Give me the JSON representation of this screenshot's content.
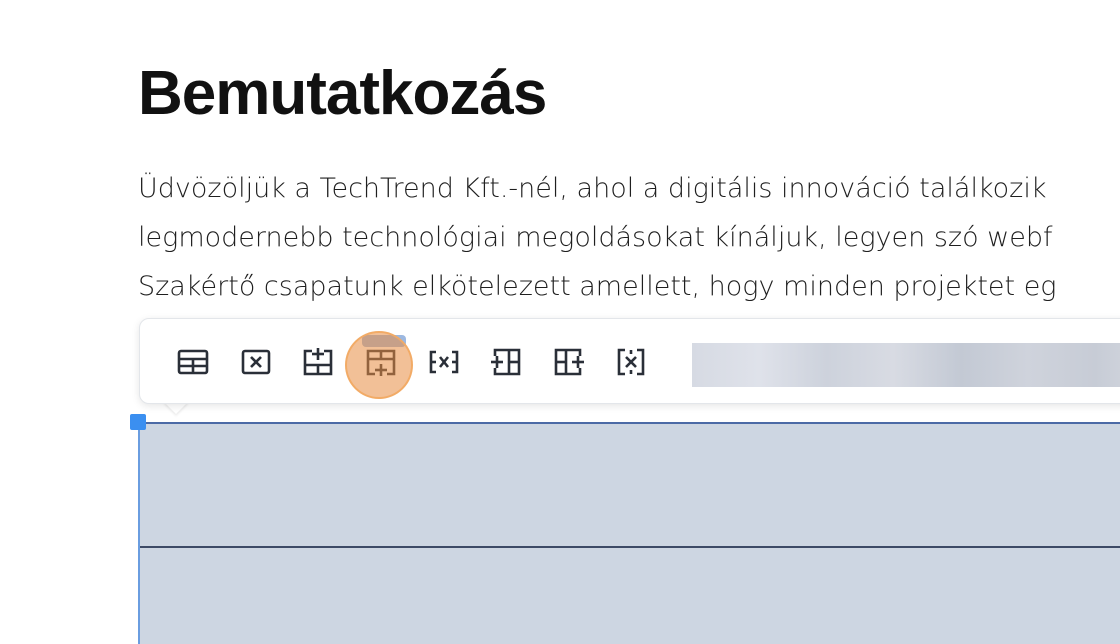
{
  "page": {
    "title": "Bemutatkozás",
    "intro_lines": [
      "Üdvözöljük a TechTrend Kft.-nél, ahol a digitális innováció találkozik",
      "legmodernebb technológiai megoldásokat kínáljuk, legyen szó webf",
      "Szakértő csapatunk elkötelezett amellett, hogy minden projektet eg"
    ]
  },
  "toolbar": {
    "tools": [
      {
        "icon": "table-icon"
      },
      {
        "icon": "delete-table-icon"
      },
      {
        "icon": "insert-row-above-icon"
      },
      {
        "icon": "insert-row-below-icon",
        "active": true
      },
      {
        "icon": "delete-row-icon"
      },
      {
        "icon": "insert-column-left-icon"
      },
      {
        "icon": "insert-column-right-icon"
      },
      {
        "icon": "delete-column-icon"
      }
    ]
  },
  "colors": {
    "accent": "#3b8ff0",
    "table_fill": "#cdd6e2",
    "click_marker": "#e88d42"
  }
}
